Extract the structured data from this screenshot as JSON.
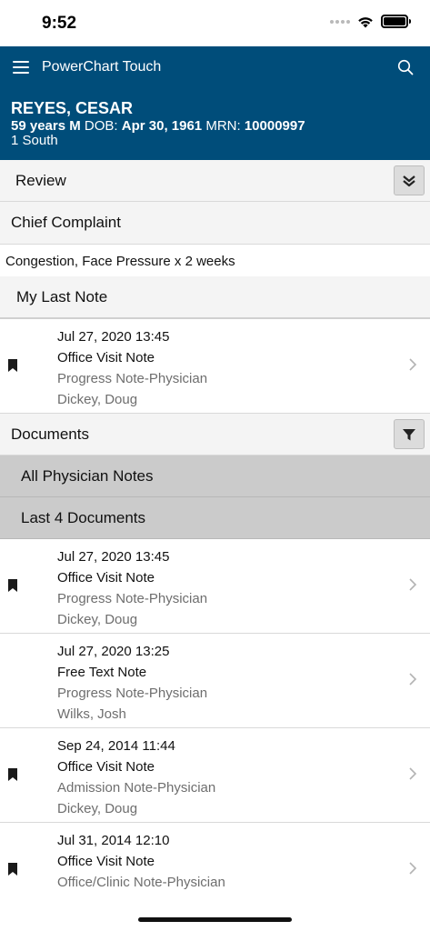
{
  "status": {
    "time": "9:52"
  },
  "header": {
    "app_title": "PowerChart Touch"
  },
  "patient": {
    "name": "REYES, CESAR",
    "age": "59 years",
    "sex": "M",
    "dob_label": "DOB:",
    "dob": "Apr 30, 1961",
    "mrn_label": "MRN:",
    "mrn": "10000997",
    "location": "1 South"
  },
  "review": {
    "label": "Review"
  },
  "chief_complaint": {
    "label": "Chief Complaint",
    "text": "Congestion, Face Pressure x 2 weeks"
  },
  "my_last_note": {
    "label": "My Last Note",
    "item": {
      "date": "Jul 27, 2020 13:45",
      "title": "Office Visit Note",
      "type": "Progress Note-Physician",
      "author": "Dickey, Doug",
      "bookmarked": true
    }
  },
  "documents": {
    "label": "Documents",
    "filters": [
      "All Physician Notes",
      "Last 4 Documents"
    ],
    "items": [
      {
        "date": "Jul 27, 2020 13:45",
        "title": "Office Visit Note",
        "type": "Progress Note-Physician",
        "author": "Dickey, Doug",
        "bookmarked": true
      },
      {
        "date": "Jul 27, 2020 13:25",
        "title": "Free Text Note",
        "type": "Progress Note-Physician",
        "author": "Wilks, Josh",
        "bookmarked": false
      },
      {
        "date": "Sep 24, 2014 11:44",
        "title": "Office Visit Note",
        "type": "Admission Note-Physician",
        "author": "Dickey, Doug",
        "bookmarked": true
      },
      {
        "date": "Jul 31, 2014 12:10",
        "title": "Office Visit Note",
        "type": "Office/Clinic Note-Physician",
        "author": "",
        "bookmarked": true
      }
    ]
  },
  "colors": {
    "header_bg": "#004d7a",
    "section_bg": "#f4f4f4",
    "filter_bg": "#cbcbcb"
  },
  "icons": {
    "menu": "menu-icon",
    "search": "search-icon",
    "expand": "double-chevron-down-icon",
    "filter": "filter-icon",
    "bookmark": "bookmark-icon",
    "chevron": "chevron-right-icon"
  }
}
